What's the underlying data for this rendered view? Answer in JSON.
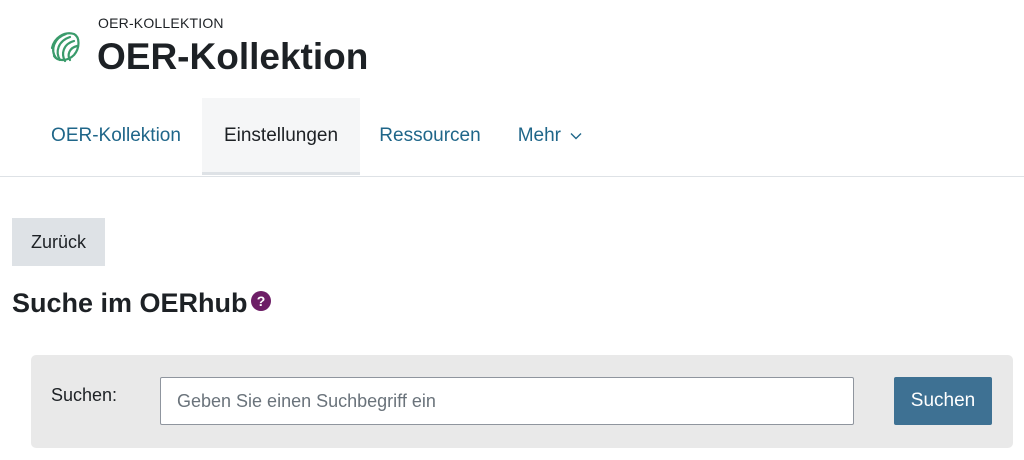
{
  "header": {
    "pre_title": "OER-KOLLEKTION",
    "title": "OER-Kollektion",
    "logo_icon": "oer-collection-icon",
    "logo_color": "#3a9b6b"
  },
  "nav": {
    "tabs": [
      {
        "label": "OER-Kollektion",
        "active": false
      },
      {
        "label": "Einstellungen",
        "active": true
      },
      {
        "label": "Ressourcen",
        "active": false
      },
      {
        "label": "Mehr",
        "active": false,
        "icon": "chevron-down-icon"
      }
    ]
  },
  "back_button": {
    "label": "Zurück"
  },
  "section": {
    "title": "Suche im OERhub",
    "help_icon": "question-circle-icon",
    "help_glyph": "?",
    "help_color": "#6d1e66"
  },
  "search": {
    "label": "Suchen:",
    "placeholder": "Geben Sie einen Suchbegriff ein",
    "value": "",
    "button_label": "Suchen",
    "button_color": "#3e7193"
  }
}
